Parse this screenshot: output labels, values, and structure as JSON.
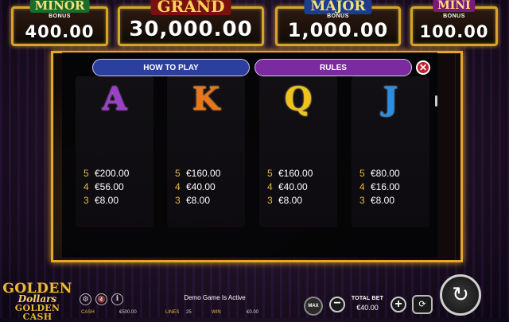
{
  "jackpots": {
    "minor": {
      "label": "MINOR",
      "sub": "BONUS",
      "value": "400.00"
    },
    "grand": {
      "label": "GRAND",
      "value": "30,000.00"
    },
    "major": {
      "label": "MAJOR",
      "sub": "BONUS",
      "value": "1,000.00"
    },
    "mini": {
      "label": "MINI",
      "sub": "BONUS",
      "value": "100.00"
    }
  },
  "tabs": {
    "how_to_play": "HOW TO PLAY",
    "rules": "RULES"
  },
  "close_glyph": "✕",
  "symbols": [
    {
      "letter": "A",
      "color": "#9b3fc9",
      "pays": [
        {
          "n": "5",
          "v": "€200.00"
        },
        {
          "n": "4",
          "v": "€56.00"
        },
        {
          "n": "3",
          "v": "€8.00"
        }
      ]
    },
    {
      "letter": "K",
      "color": "#e8771c",
      "pays": [
        {
          "n": "5",
          "v": "€160.00"
        },
        {
          "n": "4",
          "v": "€40.00"
        },
        {
          "n": "3",
          "v": "€8.00"
        }
      ]
    },
    {
      "letter": "Q",
      "color": "#f0c21c",
      "pays": [
        {
          "n": "5",
          "v": "€160.00"
        },
        {
          "n": "4",
          "v": "€40.00"
        },
        {
          "n": "3",
          "v": "€8.00"
        }
      ]
    },
    {
      "letter": "J",
      "color": "#2a8fe0",
      "pays": [
        {
          "n": "5",
          "v": "€80.00"
        },
        {
          "n": "4",
          "v": "€16.00"
        },
        {
          "n": "3",
          "v": "€8.00"
        }
      ]
    }
  ],
  "logo": {
    "line1": "GOLDEN",
    "line2": "Dollars",
    "line3": "GOLDEN CASH"
  },
  "bottom": {
    "demo_text": "Demo Game Is Active",
    "cash_label": "CASH",
    "cash_value": "€500.00",
    "lines_label": "LINES",
    "lines_value": "25",
    "win_label": "WIN",
    "win_value": "€0.00",
    "max_label": "MAX",
    "total_bet_label": "TOTAL BET",
    "total_bet_value": "€40.00",
    "minus": "−",
    "plus": "+",
    "settings_glyph": "⚙",
    "sound_glyph": "🔇",
    "info_glyph": "i",
    "auto_glyph": "⟳",
    "spin_glyph": "↻"
  },
  "colors": {
    "gold_border": "#d8a425",
    "tab_how": "#2b3f9e",
    "tab_rules": "#7b2aa0",
    "close": "#c0202a"
  }
}
